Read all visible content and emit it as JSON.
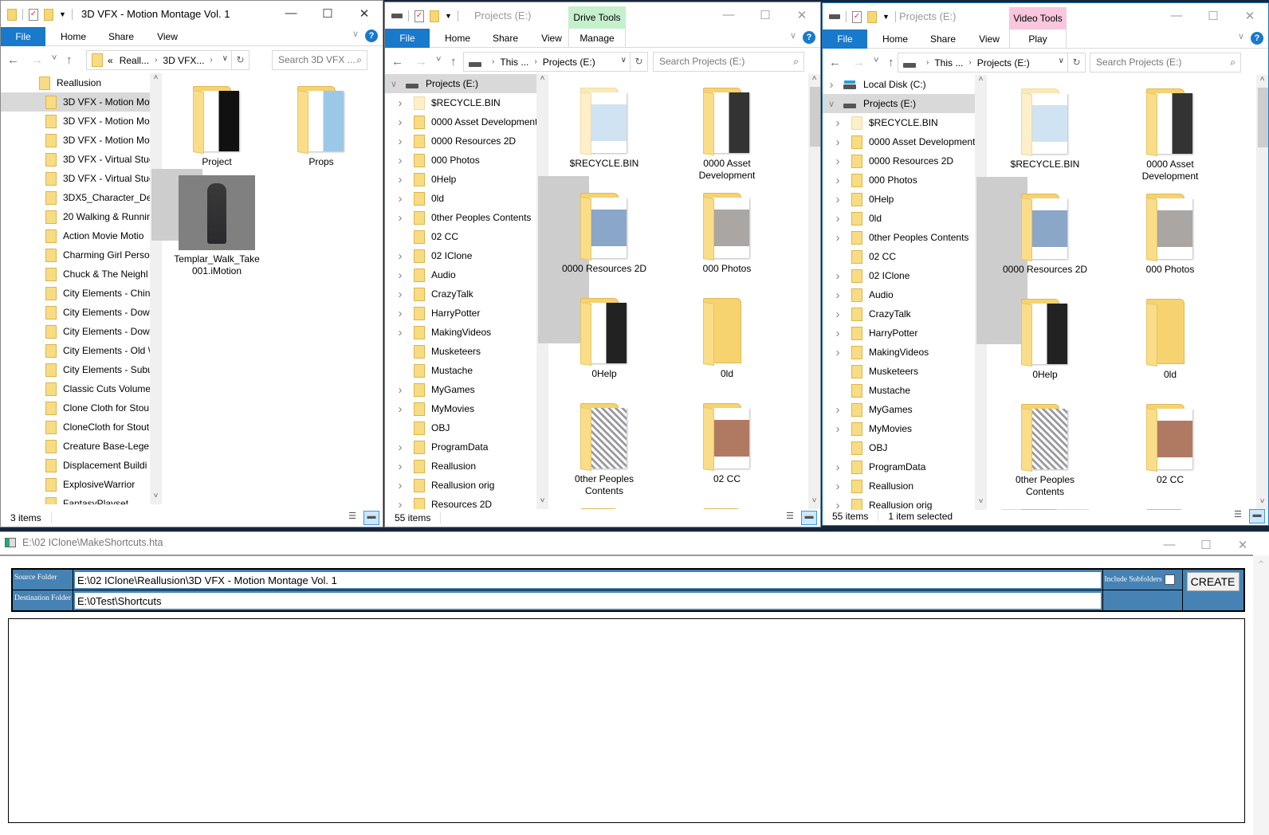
{
  "windows": [
    {
      "title": "3D VFX - Motion Montage Vol. 1",
      "quick_access_icon": "folder-icon",
      "tabs": [
        "File",
        "Home",
        "Share",
        "View"
      ],
      "address": {
        "prefix": "«",
        "crumbs": [
          "Reall...",
          "3D VFX..."
        ],
        "trailing_chevron": true,
        "icon": "folder-icon"
      },
      "search_placeholder": "Search 3D VFX ...",
      "nav": [
        {
          "label": "Reallusion",
          "indent": 0,
          "expand": "none",
          "icon": "folder"
        },
        {
          "label": "3D VFX - Motion Mo",
          "indent": 1,
          "expand": "none",
          "icon": "folder",
          "selected": true
        },
        {
          "label": "3D VFX - Motion Mo",
          "indent": 1,
          "expand": "none",
          "icon": "folder"
        },
        {
          "label": "3D VFX - Motion Mo",
          "indent": 1,
          "expand": "none",
          "icon": "folder"
        },
        {
          "label": "3D VFX - Virtual Stuc",
          "indent": 1,
          "expand": "none",
          "icon": "folder"
        },
        {
          "label": "3D VFX - Virtual Stuc",
          "indent": 1,
          "expand": "none",
          "icon": "folder"
        },
        {
          "label": "3DX5_Character_Des",
          "indent": 1,
          "expand": "none",
          "icon": "folder"
        },
        {
          "label": "20 Walking & Runnir",
          "indent": 1,
          "expand": "none",
          "icon": "folder"
        },
        {
          "label": "Action Movie Motio",
          "indent": 1,
          "expand": "none",
          "icon": "folder"
        },
        {
          "label": "Charming Girl Perso",
          "indent": 1,
          "expand": "none",
          "icon": "folder"
        },
        {
          "label": "Chuck & The Neighl",
          "indent": 1,
          "expand": "none",
          "icon": "folder"
        },
        {
          "label": "City Elements - Chin",
          "indent": 1,
          "expand": "none",
          "icon": "folder"
        },
        {
          "label": "City Elements - Dow",
          "indent": 1,
          "expand": "none",
          "icon": "folder"
        },
        {
          "label": "City Elements - Dow",
          "indent": 1,
          "expand": "none",
          "icon": "folder"
        },
        {
          "label": "City Elements - Old \\",
          "indent": 1,
          "expand": "none",
          "icon": "folder"
        },
        {
          "label": "City Elements - Subu",
          "indent": 1,
          "expand": "none",
          "icon": "folder"
        },
        {
          "label": "Classic Cuts Volume",
          "indent": 1,
          "expand": "none",
          "icon": "folder"
        },
        {
          "label": "Clone Cloth for Stou",
          "indent": 1,
          "expand": "none",
          "icon": "folder"
        },
        {
          "label": "CloneCloth for Stout",
          "indent": 1,
          "expand": "none",
          "icon": "folder"
        },
        {
          "label": "Creature Base-Legen",
          "indent": 1,
          "expand": "none",
          "icon": "folder"
        },
        {
          "label": "Displacement Buildi",
          "indent": 1,
          "expand": "none",
          "icon": "folder"
        },
        {
          "label": "ExplosiveWarrior",
          "indent": 1,
          "expand": "none",
          "icon": "folder"
        },
        {
          "label": "FantasyPlayset",
          "indent": 1,
          "expand": "none",
          "icon": "folder"
        }
      ],
      "items": [
        {
          "label": "Project",
          "thumb": "folder-document-icon",
          "paper": "#111"
        },
        {
          "label": "Props",
          "thumb": "folder-document-icon",
          "paper": "#9cc8e8"
        },
        {
          "label": "Templar_Walk_Take 001.iMotion",
          "thumb": "character-image-thumbnail"
        }
      ],
      "status": [
        "3 items"
      ]
    },
    {
      "title": "Projects (E:)",
      "quick_access_icon": "drive-icon",
      "context_tab": {
        "group": "Drive Tools",
        "tab": "Manage",
        "color": "#c6efce"
      },
      "tabs": [
        "File",
        "Home",
        "Share",
        "View"
      ],
      "address": {
        "prefix": "",
        "crumbs": [
          "This ...",
          "Projects (E:)"
        ],
        "trailing_chevron": false,
        "icon": "drive-icon"
      },
      "search_placeholder": "Search Projects (E:)",
      "nav": [
        {
          "label": "Projects (E:)",
          "indent": 0,
          "expand": "expanded",
          "icon": "drive",
          "selected": true
        },
        {
          "label": "$RECYCLE.BIN",
          "indent": 1,
          "expand": "collapsed",
          "icon": "folder-pale"
        },
        {
          "label": "0000 Asset Development",
          "indent": 1,
          "expand": "collapsed",
          "icon": "folder"
        },
        {
          "label": "0000 Resources 2D",
          "indent": 1,
          "expand": "collapsed",
          "icon": "folder"
        },
        {
          "label": "000 Photos",
          "indent": 1,
          "expand": "collapsed",
          "icon": "folder"
        },
        {
          "label": "0Help",
          "indent": 1,
          "expand": "collapsed",
          "icon": "folder"
        },
        {
          "label": "0ld",
          "indent": 1,
          "expand": "collapsed",
          "icon": "folder"
        },
        {
          "label": "0ther Peoples Contents",
          "indent": 1,
          "expand": "collapsed",
          "icon": "folder"
        },
        {
          "label": "02 CC",
          "indent": 1,
          "expand": "none",
          "icon": "folder"
        },
        {
          "label": "02 IClone",
          "indent": 1,
          "expand": "collapsed",
          "icon": "folder"
        },
        {
          "label": "Audio",
          "indent": 1,
          "expand": "collapsed",
          "icon": "folder"
        },
        {
          "label": "CrazyTalk",
          "indent": 1,
          "expand": "collapsed",
          "icon": "folder"
        },
        {
          "label": "HarryPotter",
          "indent": 1,
          "expand": "collapsed",
          "icon": "folder"
        },
        {
          "label": "MakingVideos",
          "indent": 1,
          "expand": "collapsed",
          "icon": "folder"
        },
        {
          "label": "Musketeers",
          "indent": 1,
          "expand": "none",
          "icon": "folder"
        },
        {
          "label": "Mustache",
          "indent": 1,
          "expand": "none",
          "icon": "folder"
        },
        {
          "label": "MyGames",
          "indent": 1,
          "expand": "collapsed",
          "icon": "folder"
        },
        {
          "label": "MyMovies",
          "indent": 1,
          "expand": "collapsed",
          "icon": "folder"
        },
        {
          "label": "OBJ",
          "indent": 1,
          "expand": "none",
          "icon": "folder"
        },
        {
          "label": "ProgramData",
          "indent": 1,
          "expand": "collapsed",
          "icon": "folder"
        },
        {
          "label": "Reallusion",
          "indent": 1,
          "expand": "collapsed",
          "icon": "folder"
        },
        {
          "label": "Reallusion orig",
          "indent": 1,
          "expand": "collapsed",
          "icon": "folder"
        },
        {
          "label": "Resources 2D",
          "indent": 1,
          "expand": "collapsed",
          "icon": "folder"
        }
      ],
      "items": [
        {
          "label": "$RECYCLE.BIN",
          "thumb": "pale-folder-icon",
          "paper": "#cfe3f3"
        },
        {
          "label": "0000 Asset Development",
          "thumb": "folder-document-icon",
          "paper": "#333"
        },
        {
          "label": "0000 Resources 2D",
          "thumb": "folder-photo-icon",
          "paper": "#8aa6c8"
        },
        {
          "label": "000 Photos",
          "thumb": "folder-photo-icon",
          "paper": "#a9a6a4"
        },
        {
          "label": "0Help",
          "thumb": "folder-document-icon",
          "paper": "#222"
        },
        {
          "label": "0ld",
          "thumb": "folder-icon",
          "paper": "#ffffff"
        },
        {
          "label": "0ther Peoples Contents",
          "thumb": "folder-pattern-icon",
          "paper": "#9a9aa0"
        },
        {
          "label": "02 CC",
          "thumb": "folder-photo-icon",
          "paper": "#b07a62"
        },
        {
          "label": "",
          "thumb": "folder-icon",
          "paper": "#ffffff"
        },
        {
          "label": "",
          "thumb": "folder-icon",
          "paper": "#ffffff"
        }
      ],
      "status": [
        "55 items"
      ]
    },
    {
      "title": "Projects (E:)",
      "quick_access_icon": "drive-icon",
      "context_tab": {
        "group": "Video Tools",
        "tab": "Play",
        "color": "#f9c6de"
      },
      "tabs": [
        "File",
        "Home",
        "Share",
        "View"
      ],
      "address": {
        "prefix": "",
        "crumbs": [
          "This ...",
          "Projects (E:)"
        ],
        "trailing_chevron": false,
        "icon": "drive-icon"
      },
      "search_placeholder": "Search Projects (E:)",
      "nav": [
        {
          "label": "Local Disk (C:)",
          "indent": 0,
          "expand": "collapsed",
          "icon": "drive-c"
        },
        {
          "label": "Projects (E:)",
          "indent": 0,
          "expand": "expanded",
          "icon": "drive",
          "selected": true
        },
        {
          "label": "$RECYCLE.BIN",
          "indent": 1,
          "expand": "collapsed",
          "icon": "folder-pale"
        },
        {
          "label": "0000 Asset Development",
          "indent": 1,
          "expand": "collapsed",
          "icon": "folder"
        },
        {
          "label": "0000 Resources 2D",
          "indent": 1,
          "expand": "collapsed",
          "icon": "folder"
        },
        {
          "label": "000 Photos",
          "indent": 1,
          "expand": "collapsed",
          "icon": "folder"
        },
        {
          "label": "0Help",
          "indent": 1,
          "expand": "collapsed",
          "icon": "folder"
        },
        {
          "label": "0ld",
          "indent": 1,
          "expand": "collapsed",
          "icon": "folder"
        },
        {
          "label": "0ther Peoples Contents",
          "indent": 1,
          "expand": "collapsed",
          "icon": "folder"
        },
        {
          "label": "02 CC",
          "indent": 1,
          "expand": "none",
          "icon": "folder"
        },
        {
          "label": "02 IClone",
          "indent": 1,
          "expand": "collapsed",
          "icon": "folder"
        },
        {
          "label": "Audio",
          "indent": 1,
          "expand": "collapsed",
          "icon": "folder"
        },
        {
          "label": "CrazyTalk",
          "indent": 1,
          "expand": "collapsed",
          "icon": "folder"
        },
        {
          "label": "HarryPotter",
          "indent": 1,
          "expand": "collapsed",
          "icon": "folder"
        },
        {
          "label": "MakingVideos",
          "indent": 1,
          "expand": "collapsed",
          "icon": "folder"
        },
        {
          "label": "Musketeers",
          "indent": 1,
          "expand": "none",
          "icon": "folder"
        },
        {
          "label": "Mustache",
          "indent": 1,
          "expand": "none",
          "icon": "folder"
        },
        {
          "label": "MyGames",
          "indent": 1,
          "expand": "collapsed",
          "icon": "folder"
        },
        {
          "label": "MyMovies",
          "indent": 1,
          "expand": "collapsed",
          "icon": "folder"
        },
        {
          "label": "OBJ",
          "indent": 1,
          "expand": "none",
          "icon": "folder"
        },
        {
          "label": "ProgramData",
          "indent": 1,
          "expand": "collapsed",
          "icon": "folder"
        },
        {
          "label": "Reallusion",
          "indent": 1,
          "expand": "collapsed",
          "icon": "folder"
        },
        {
          "label": "Reallusion orig",
          "indent": 1,
          "expand": "collapsed",
          "icon": "folder"
        }
      ],
      "items": [
        {
          "label": "$RECYCLE.BIN",
          "thumb": "pale-folder-icon",
          "paper": "#cfe3f3"
        },
        {
          "label": "0000 Asset Development",
          "thumb": "folder-document-icon",
          "paper": "#333"
        },
        {
          "label": "0000 Resources 2D",
          "thumb": "folder-photo-icon",
          "paper": "#8aa6c8"
        },
        {
          "label": "000 Photos",
          "thumb": "folder-photo-icon",
          "paper": "#a9a6a4"
        },
        {
          "label": "0Help",
          "thumb": "folder-document-icon",
          "paper": "#222"
        },
        {
          "label": "0ld",
          "thumb": "folder-icon",
          "paper": "#ffffff"
        },
        {
          "label": "0ther Peoples Contents",
          "thumb": "folder-pattern-icon",
          "paper": "#9a9aa0"
        },
        {
          "label": "02 CC",
          "thumb": "folder-photo-icon",
          "paper": "#b07a62"
        },
        {
          "label": "",
          "thumb": "folder-icon",
          "paper": "#ffffff",
          "selected": true
        },
        {
          "label": "",
          "thumb": "folder-icon",
          "paper": "#ffffff"
        }
      ],
      "status": [
        "55 items",
        "1 item selected"
      ]
    }
  ],
  "hta": {
    "title": "E:\\02 IClone\\MakeShortcuts.hta",
    "source_label": "Source Folder",
    "source_value": "E:\\02 IClone\\Reallusion\\3D VFX - Motion Montage Vol. 1",
    "destination_label": "Destination Folder",
    "destination_value": "E:\\0Test\\Shortcuts",
    "include_subfolders_label": "Include Subfolders",
    "include_subfolders_checked": false,
    "create_label": "CREATE",
    "panel_color": "#4682b4"
  }
}
